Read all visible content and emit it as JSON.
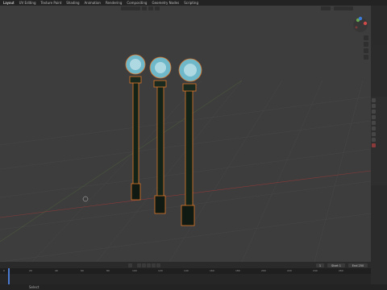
{
  "top_bar": {
    "workspace_tabs": [
      "Layout",
      "UV Editing",
      "Texture Paint",
      "Shading",
      "Animation",
      "Rendering",
      "Compositing",
      "Geometry Nodes",
      "Scripting"
    ],
    "active_tab": "Layout"
  },
  "viewport": {
    "mode_label": "Global",
    "object_count": 3
  },
  "timeline": {
    "ruler_ticks": [
      "0",
      "20",
      "40",
      "60",
      "80",
      "100",
      "120",
      "140",
      "160",
      "180",
      "200",
      "220",
      "240",
      "260"
    ],
    "start_label": "Start",
    "start_value": "1",
    "end_label": "End",
    "end_value": "250"
  },
  "status": {
    "text": "Select"
  },
  "colors": {
    "viewport_bg": "#3d3d3d",
    "selection_outline": "#e0782a",
    "lamp_body": "#132318",
    "globe": "#6fb8c9"
  }
}
